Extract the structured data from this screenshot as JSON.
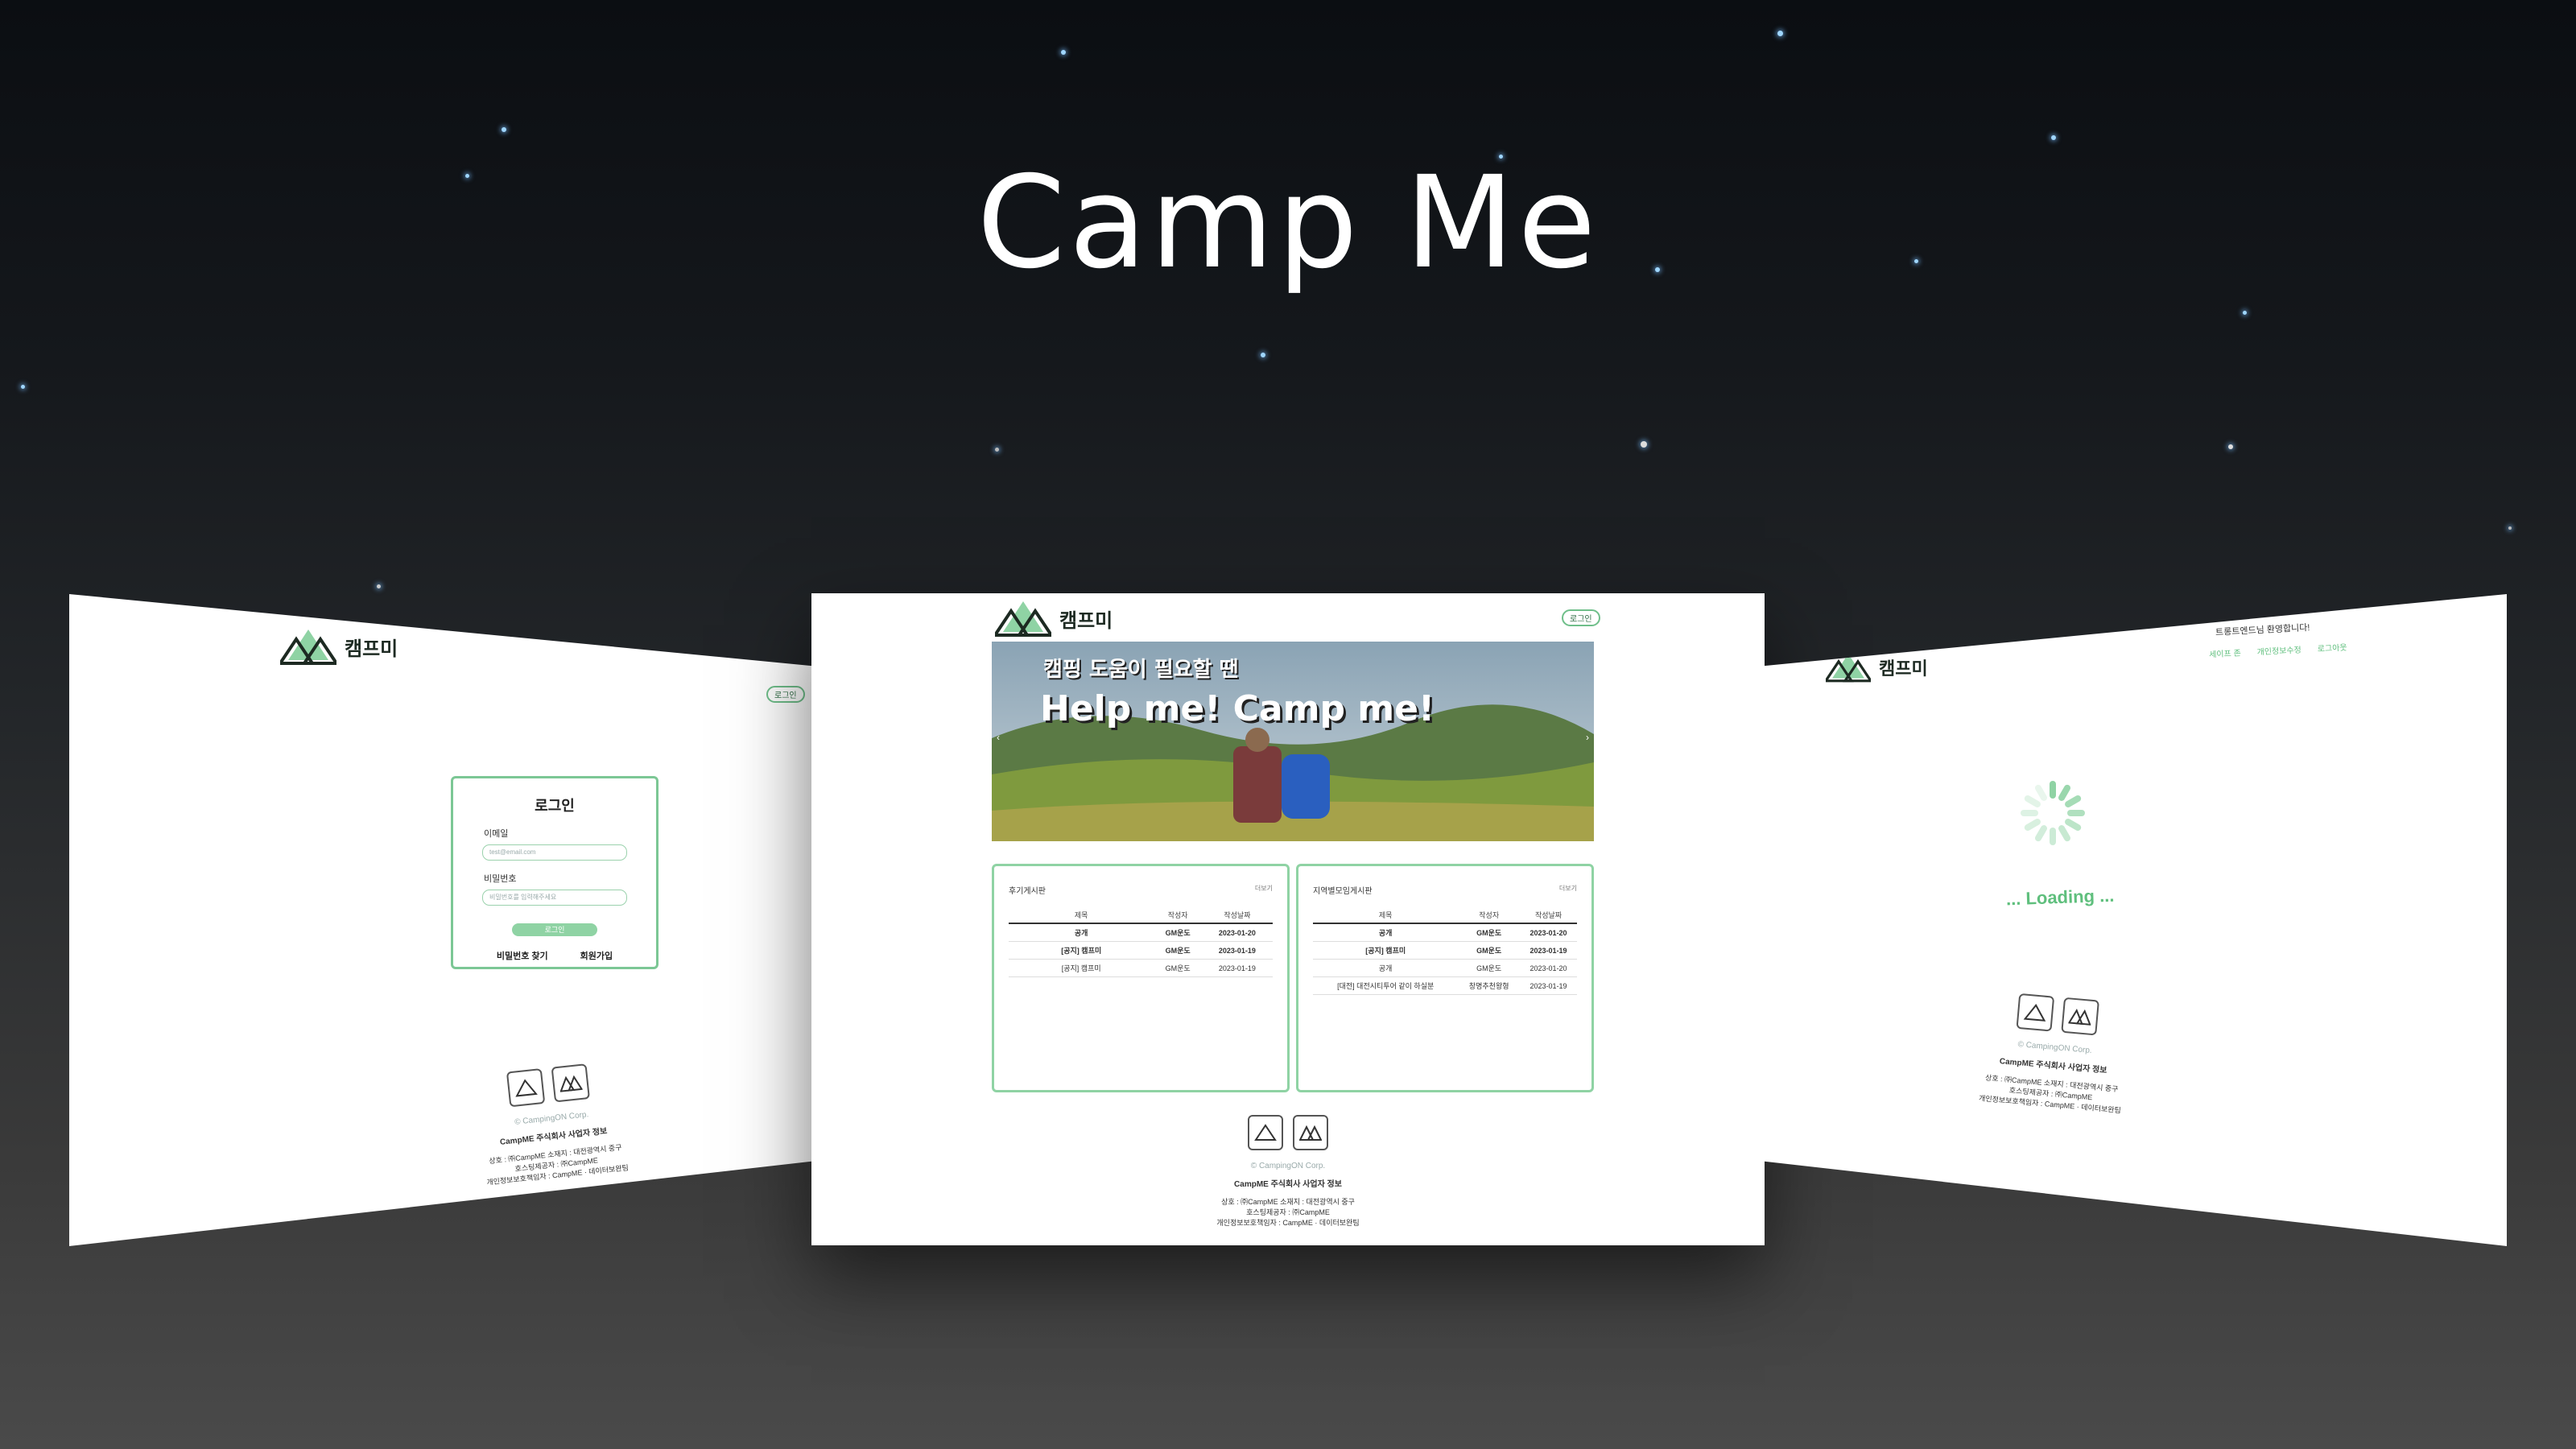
{
  "title": "Camp Me",
  "login_page": {
    "brand": "캠프미",
    "top_button": "로그인",
    "box_title": "로그인",
    "email_label": "이메일",
    "email_placeholder": "test@email.com",
    "password_label": "비밀번호",
    "password_placeholder": "비밀번호를 입력해주세요",
    "submit_label": "로그인",
    "find_password": "비밀번호 찾기",
    "signup": "회원가입"
  },
  "main_page": {
    "brand": "캠프미",
    "top_button": "로그인",
    "banner_line1": "캠핑 도움이 필요할 땐",
    "banner_line2": "Help me!  Camp me!",
    "review_board": {
      "title": "후기게시판",
      "more": "더보기",
      "headers": [
        "제목",
        "작성자",
        "작성날짜"
      ],
      "rows": [
        [
          "공개",
          "GM운도",
          "2023-01-20"
        ],
        [
          "[공지] 캠프미",
          "GM운도",
          "2023-01-19"
        ],
        [
          "[공지] 캠프미",
          "GM운도",
          "2023-01-19"
        ]
      ]
    },
    "region_board": {
      "title": "지역별모임게시판",
      "more": "더보기",
      "headers": [
        "제목",
        "작성자",
        "작성날짜"
      ],
      "rows": [
        [
          "공개",
          "GM운도",
          "2023-01-20"
        ],
        [
          "[공지] 캠프미",
          "GM운도",
          "2023-01-19"
        ],
        [
          "공개",
          "GM운도",
          "2023-01-20"
        ],
        [
          "[대전] 대전시티투어 같이 하실분",
          "창명추천왕형",
          "2023-01-19"
        ]
      ]
    }
  },
  "loading_page": {
    "brand": "캠프미",
    "welcome": "트롱트엔드님 환영합니다!",
    "nav": [
      "세이프 존",
      "개인정보수정",
      "로그아웃"
    ],
    "loading_text": "... Loading ..."
  },
  "footer": {
    "copyright": "© CampingON Corp.",
    "company": "CampME 주식회사 사업자 정보",
    "line1": "상호 : ㈜CampME 소재지 : 대전광역시 중구",
    "line2": "호스팅제공자 : ㈜CampME",
    "line3": "개인정보보호책임자 : CampME · 데이터보완팀"
  },
  "colors": {
    "accent": "#6fbf8a",
    "background_top": "#0b0e12",
    "background_bottom": "#4a4a4a"
  }
}
